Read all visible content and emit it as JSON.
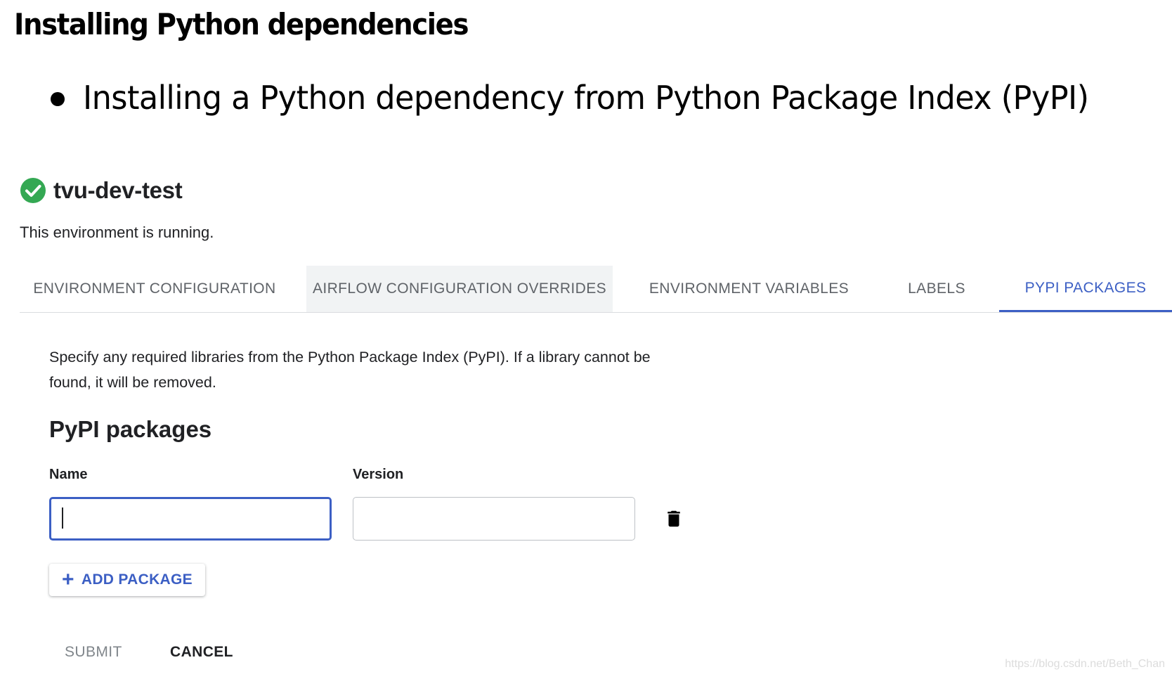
{
  "slide": {
    "title": "Installing Python dependencies",
    "bullet": "Installing a Python dependency from Python Package Index (PyPI)"
  },
  "environment": {
    "name": "tvu-dev-test",
    "status": "This environment is running.",
    "status_icon": "check-circle-icon",
    "status_color": "#34a853"
  },
  "tabs": [
    {
      "label": "ENVIRONMENT CONFIGURATION",
      "state": "default"
    },
    {
      "label": "AIRFLOW CONFIGURATION OVERRIDES",
      "state": "hovered"
    },
    {
      "label": "ENVIRONMENT VARIABLES",
      "state": "default"
    },
    {
      "label": "LABELS",
      "state": "default"
    },
    {
      "label": "PYPI PACKAGES",
      "state": "active"
    }
  ],
  "pypi": {
    "description": "Specify any required libraries from the Python Package Index (PyPI). If a library cannot be found, it will be removed.",
    "section_title": "PyPI packages",
    "name_label": "Name",
    "version_label": "Version",
    "name_value": "",
    "version_value": "",
    "delete_icon": "trash-icon",
    "add_label": "ADD PACKAGE",
    "add_icon": "plus-icon"
  },
  "actions": {
    "submit": "SUBMIT",
    "cancel": "CANCEL"
  },
  "colors": {
    "accent": "#3c5fc4",
    "success": "#34a853",
    "disabled": "#80868b"
  },
  "watermark": "https://blog.csdn.net/Beth_Chan"
}
